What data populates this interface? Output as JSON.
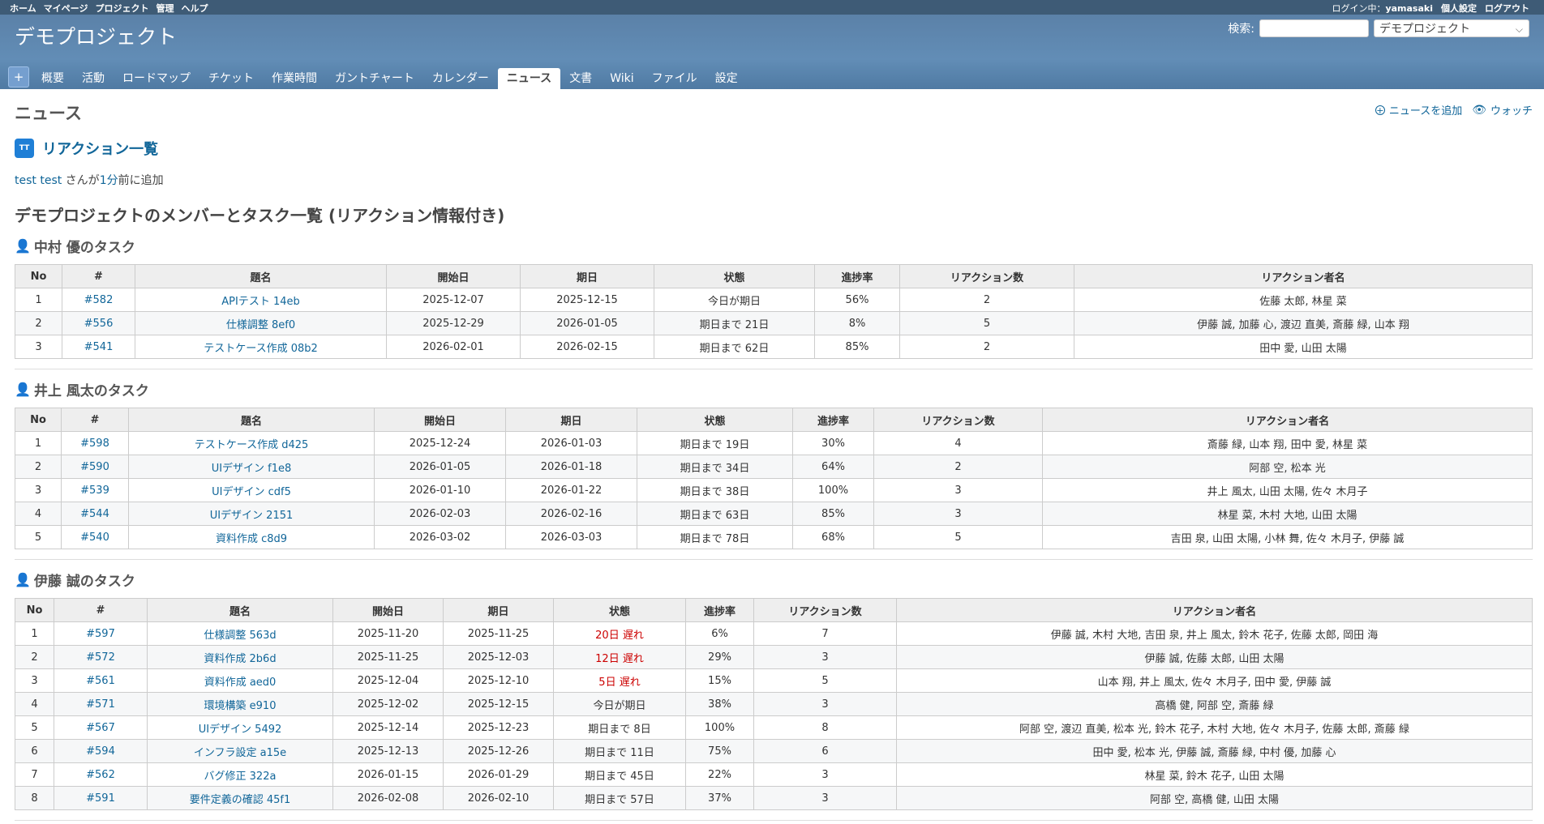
{
  "top_menu": {
    "left": [
      "ホーム",
      "マイページ",
      "プロジェクト",
      "管理",
      "ヘルプ"
    ],
    "login_label": "ログイン中：",
    "login_user": "yamasaki",
    "my_account": "個人設定",
    "logout": "ログアウト"
  },
  "header": {
    "project_title": "デモプロジェクト",
    "search_label": "検索:",
    "search_value": "",
    "project_select": "デモプロジェクト",
    "plus_label": "+",
    "tabs": [
      "概要",
      "活動",
      "ロードマップ",
      "チケット",
      "作業時間",
      "ガントチャート",
      "カレンダー",
      "ニュース",
      "文書",
      "Wiki",
      "ファイル",
      "設定"
    ],
    "selected_tab": "ニュース"
  },
  "page": {
    "title": "ニュース",
    "add_news": "ニュースを追加",
    "watch": "ウォッチ",
    "avatar_initials": "TT",
    "news_title": "リアクション一覧",
    "author_name": "test test",
    "author_mid": " さんが",
    "author_time": "1分",
    "author_suffix": "前に追加",
    "heading": "デモプロジェクトのメンバーとタスク一覧 (リアクション情報付き)"
  },
  "columns": [
    "No",
    "#",
    "題名",
    "開始日",
    "期日",
    "状態",
    "進捗率",
    "リアクション数",
    "リアクション者名"
  ],
  "members": [
    {
      "title": "中村 優のタスク",
      "rows": [
        [
          "1",
          "#582",
          "APIテスト 14eb",
          "2025-12-07",
          "2025-12-15",
          "今日が期日",
          "56%",
          "2",
          "佐藤 太郎, 林星 菜"
        ],
        [
          "2",
          "#556",
          "仕様調整 8ef0",
          "2025-12-29",
          "2026-01-05",
          "期日まで 21日",
          "8%",
          "5",
          "伊藤 誠, 加藤 心, 渡辺 直美, 斎藤 緑, 山本 翔"
        ],
        [
          "3",
          "#541",
          "テストケース作成 08b2",
          "2026-02-01",
          "2026-02-15",
          "期日まで 62日",
          "85%",
          "2",
          "田中 愛, 山田 太陽"
        ]
      ]
    },
    {
      "title": "井上 風太のタスク",
      "rows": [
        [
          "1",
          "#598",
          "テストケース作成 d425",
          "2025-12-24",
          "2026-01-03",
          "期日まで 19日",
          "30%",
          "4",
          "斎藤 緑, 山本 翔, 田中 愛, 林星 菜"
        ],
        [
          "2",
          "#590",
          "UIデザイン f1e8",
          "2026-01-05",
          "2026-01-18",
          "期日まで 34日",
          "64%",
          "2",
          "阿部 空, 松本 光"
        ],
        [
          "3",
          "#539",
          "UIデザイン cdf5",
          "2026-01-10",
          "2026-01-22",
          "期日まで 38日",
          "100%",
          "3",
          "井上 風太, 山田 太陽, 佐々 木月子"
        ],
        [
          "4",
          "#544",
          "UIデザイン 2151",
          "2026-02-03",
          "2026-02-16",
          "期日まで 63日",
          "85%",
          "3",
          "林星 菜, 木村 大地, 山田 太陽"
        ],
        [
          "5",
          "#540",
          "資料作成 c8d9",
          "2026-03-02",
          "2026-03-03",
          "期日まで 78日",
          "68%",
          "5",
          "吉田 泉, 山田 太陽, 小林 舞, 佐々 木月子, 伊藤 誠"
        ]
      ]
    },
    {
      "title": "伊藤 誠のタスク",
      "rows": [
        [
          "1",
          "#597",
          "仕様調整 563d",
          "2025-11-20",
          "2025-11-25",
          "20日 遅れ",
          "6%",
          "7",
          "伊藤 誠, 木村 大地, 吉田 泉, 井上 風太, 鈴木 花子, 佐藤 太郎, 岡田 海"
        ],
        [
          "2",
          "#572",
          "資料作成 2b6d",
          "2025-11-25",
          "2025-12-03",
          "12日 遅れ",
          "29%",
          "3",
          "伊藤 誠, 佐藤 太郎, 山田 太陽"
        ],
        [
          "3",
          "#561",
          "資料作成 aed0",
          "2025-12-04",
          "2025-12-10",
          "5日 遅れ",
          "15%",
          "5",
          "山本 翔, 井上 風太, 佐々 木月子, 田中 愛, 伊藤 誠"
        ],
        [
          "4",
          "#571",
          "環境構築 e910",
          "2025-12-02",
          "2025-12-15",
          "今日が期日",
          "38%",
          "3",
          "高橋 健, 阿部 空, 斎藤 緑"
        ],
        [
          "5",
          "#567",
          "UIデザイン 5492",
          "2025-12-14",
          "2025-12-23",
          "期日まで 8日",
          "100%",
          "8",
          "阿部 空, 渡辺 直美, 松本 光, 鈴木 花子, 木村 大地, 佐々 木月子, 佐藤 太郎, 斎藤 緑"
        ],
        [
          "6",
          "#594",
          "インフラ設定 a15e",
          "2025-12-13",
          "2025-12-26",
          "期日まで 11日",
          "75%",
          "6",
          "田中 愛, 松本 光, 伊藤 誠, 斎藤 緑, 中村 優, 加藤 心"
        ],
        [
          "7",
          "#562",
          "バグ修正 322a",
          "2026-01-15",
          "2026-01-29",
          "期日まで 45日",
          "22%",
          "3",
          "林星 菜, 鈴木 花子, 山田 太陽"
        ],
        [
          "8",
          "#591",
          "要件定義の確認 45f1",
          "2026-02-08",
          "2026-02-10",
          "期日まで 57日",
          "37%",
          "3",
          "阿部 空, 高橋 健, 山田 太陽"
        ]
      ]
    }
  ]
}
